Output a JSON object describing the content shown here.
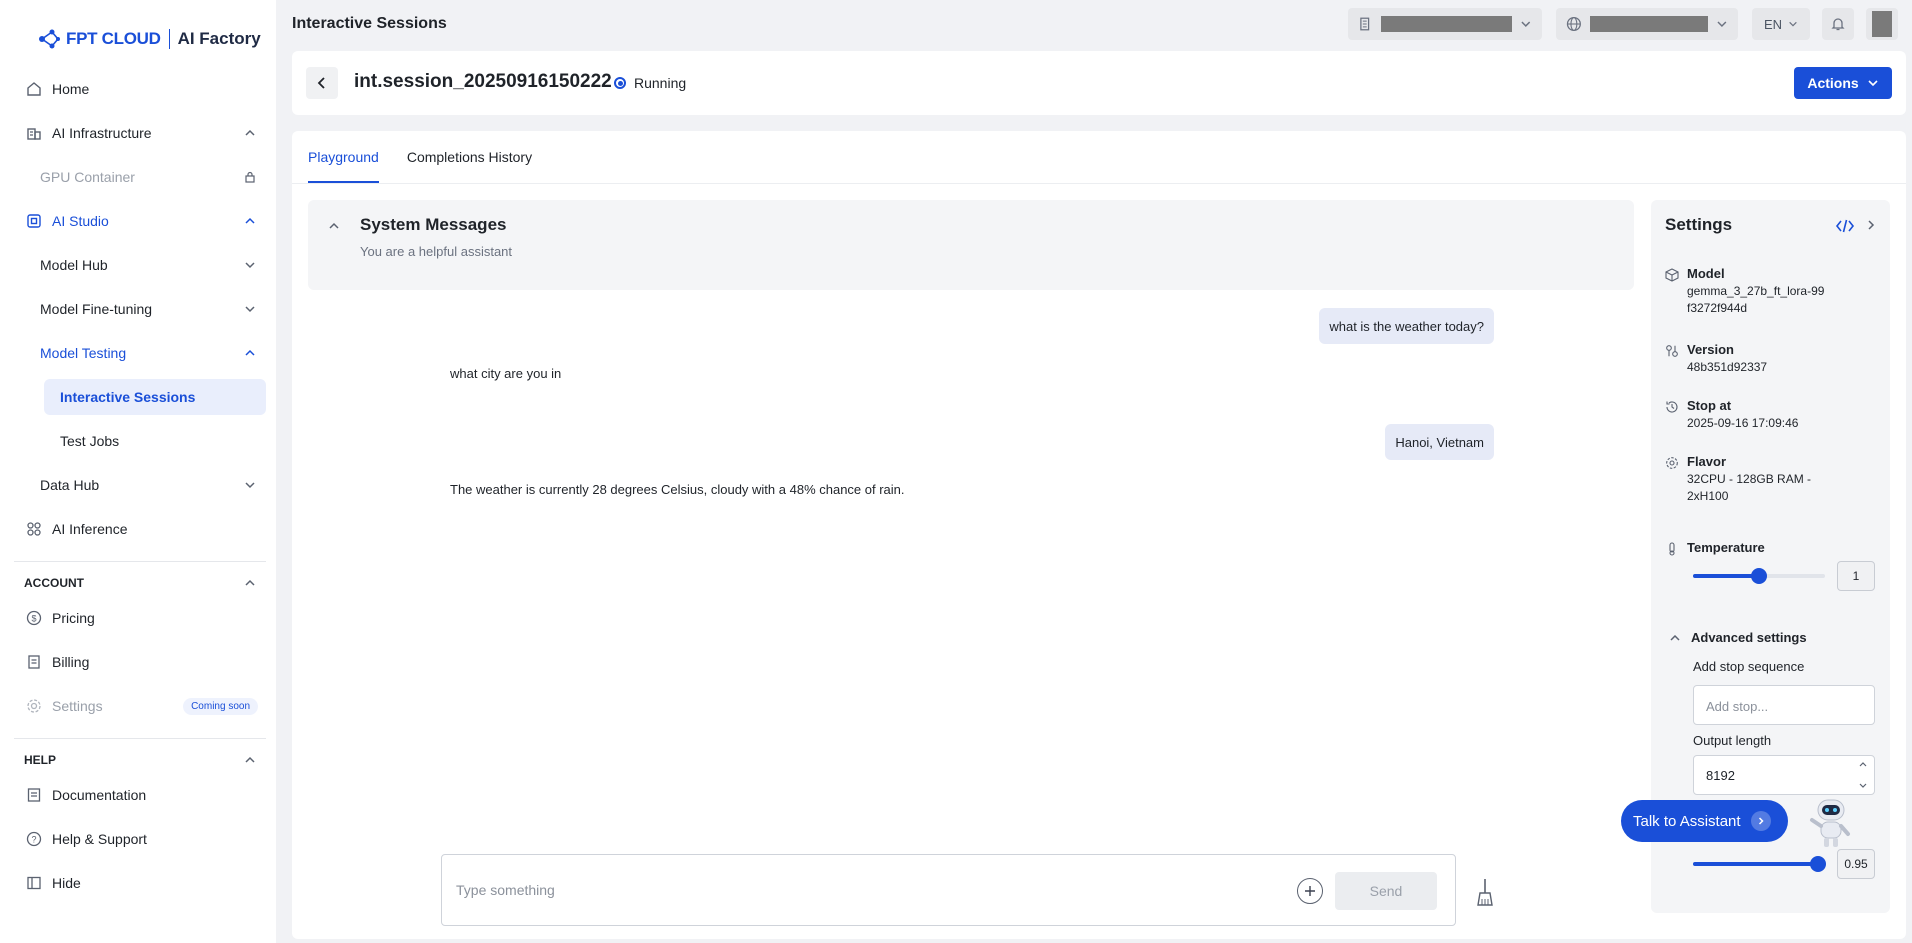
{
  "brand": {
    "name": "FPT CLOUD",
    "product": "AI Factory",
    "accent": "#1a4fd8"
  },
  "sidebar": {
    "home": "Home",
    "ai_infrastructure": "AI Infrastructure",
    "gpu_container": "GPU Container",
    "ai_studio": "AI Studio",
    "model_hub": "Model Hub",
    "model_fine_tuning": "Model Fine-tuning",
    "model_testing": "Model Testing",
    "interactive_sessions": "Interactive Sessions",
    "test_jobs": "Test Jobs",
    "data_hub": "Data Hub",
    "ai_inference": "AI Inference",
    "account_section": "ACCOUNT",
    "pricing": "Pricing",
    "billing": "Billing",
    "settings": "Settings",
    "coming_soon": "Coming soon",
    "help_section": "HELP",
    "documentation": "Documentation",
    "help_support": "Help & Support",
    "hide": "Hide"
  },
  "topbar": {
    "title": "Interactive Sessions",
    "language": "EN"
  },
  "header": {
    "session_name": "int.session_20250916150222",
    "status": "Running",
    "actions_label": "Actions"
  },
  "tabs": [
    "Playground",
    "Completions History"
  ],
  "system_messages": {
    "title": "System Messages",
    "content": "You are a helpful assistant"
  },
  "messages": [
    {
      "role": "user",
      "text": "what is the weather today?"
    },
    {
      "role": "assistant",
      "text": "what city are you in"
    },
    {
      "role": "user",
      "text": "Hanoi, Vietnam"
    },
    {
      "role": "assistant",
      "text": "The weather is currently 28 degrees Celsius, cloudy with a 48% chance of rain."
    }
  ],
  "composer": {
    "placeholder": "Type something",
    "send_label": "Send"
  },
  "settings": {
    "title": "Settings",
    "model_label": "Model",
    "model_value": "gemma_3_27b_ft_lora-99f3272f944d",
    "version_label": "Version",
    "version_value": "48b351d92337",
    "stop_at_label": "Stop at",
    "stop_at_value": "2025-09-16 17:09:46",
    "flavor_label": "Flavor",
    "flavor_value": "32CPU - 128GB RAM - 2xH100",
    "temperature_label": "Temperature",
    "temperature_value": "1",
    "temperature_fraction": 0.5,
    "advanced_label": "Advanced settings",
    "stop_sequence_label": "Add stop sequence",
    "stop_sequence_placeholder": "Add stop...",
    "output_length_label": "Output length",
    "output_length_value": "8192",
    "top_p_value": "0.95",
    "top_p_fraction": 0.95
  },
  "assistant": {
    "label": "Talk to Assistant"
  }
}
